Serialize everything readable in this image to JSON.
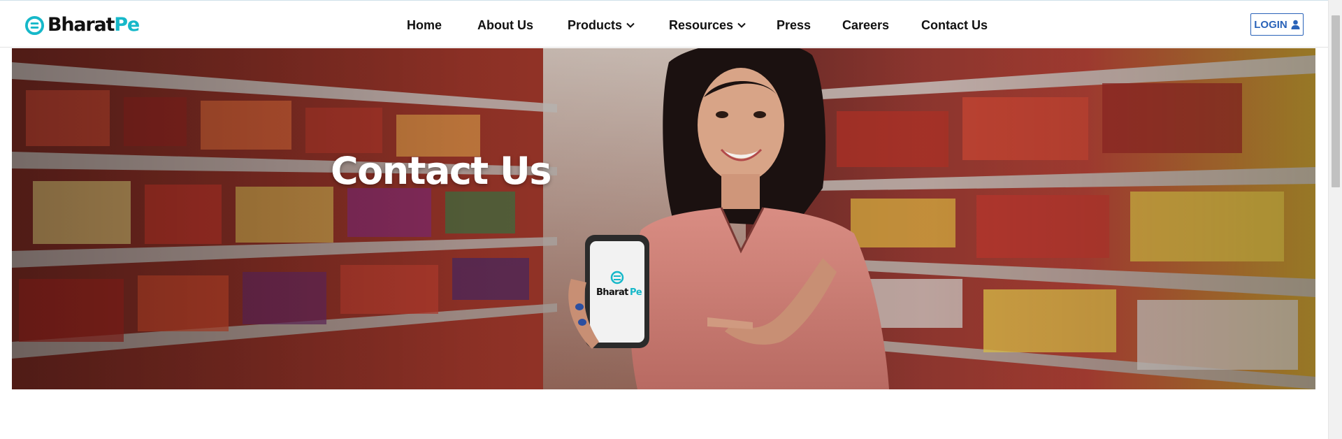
{
  "brand": {
    "name_part1": "Bharat",
    "name_part2": "Pe",
    "logo_icon": "bharatpe-logo-icon",
    "accent_color": "#16b8c9"
  },
  "nav": {
    "items": [
      {
        "label": "Home",
        "has_dropdown": false
      },
      {
        "label": "About Us",
        "has_dropdown": false
      },
      {
        "label": "Products",
        "has_dropdown": true
      },
      {
        "label": "Resources",
        "has_dropdown": true
      },
      {
        "label": "Press",
        "has_dropdown": false
      },
      {
        "label": "Careers",
        "has_dropdown": false
      },
      {
        "label": "Contact Us",
        "has_dropdown": false
      }
    ]
  },
  "login": {
    "label": "LOGIN",
    "icon": "user-icon",
    "color": "#2a63b9"
  },
  "hero": {
    "title": "Contact Us",
    "image": "woman-holding-phone-in-grocery-store",
    "phone_brand_part1": "Bharat",
    "phone_brand_part2": "Pe"
  }
}
